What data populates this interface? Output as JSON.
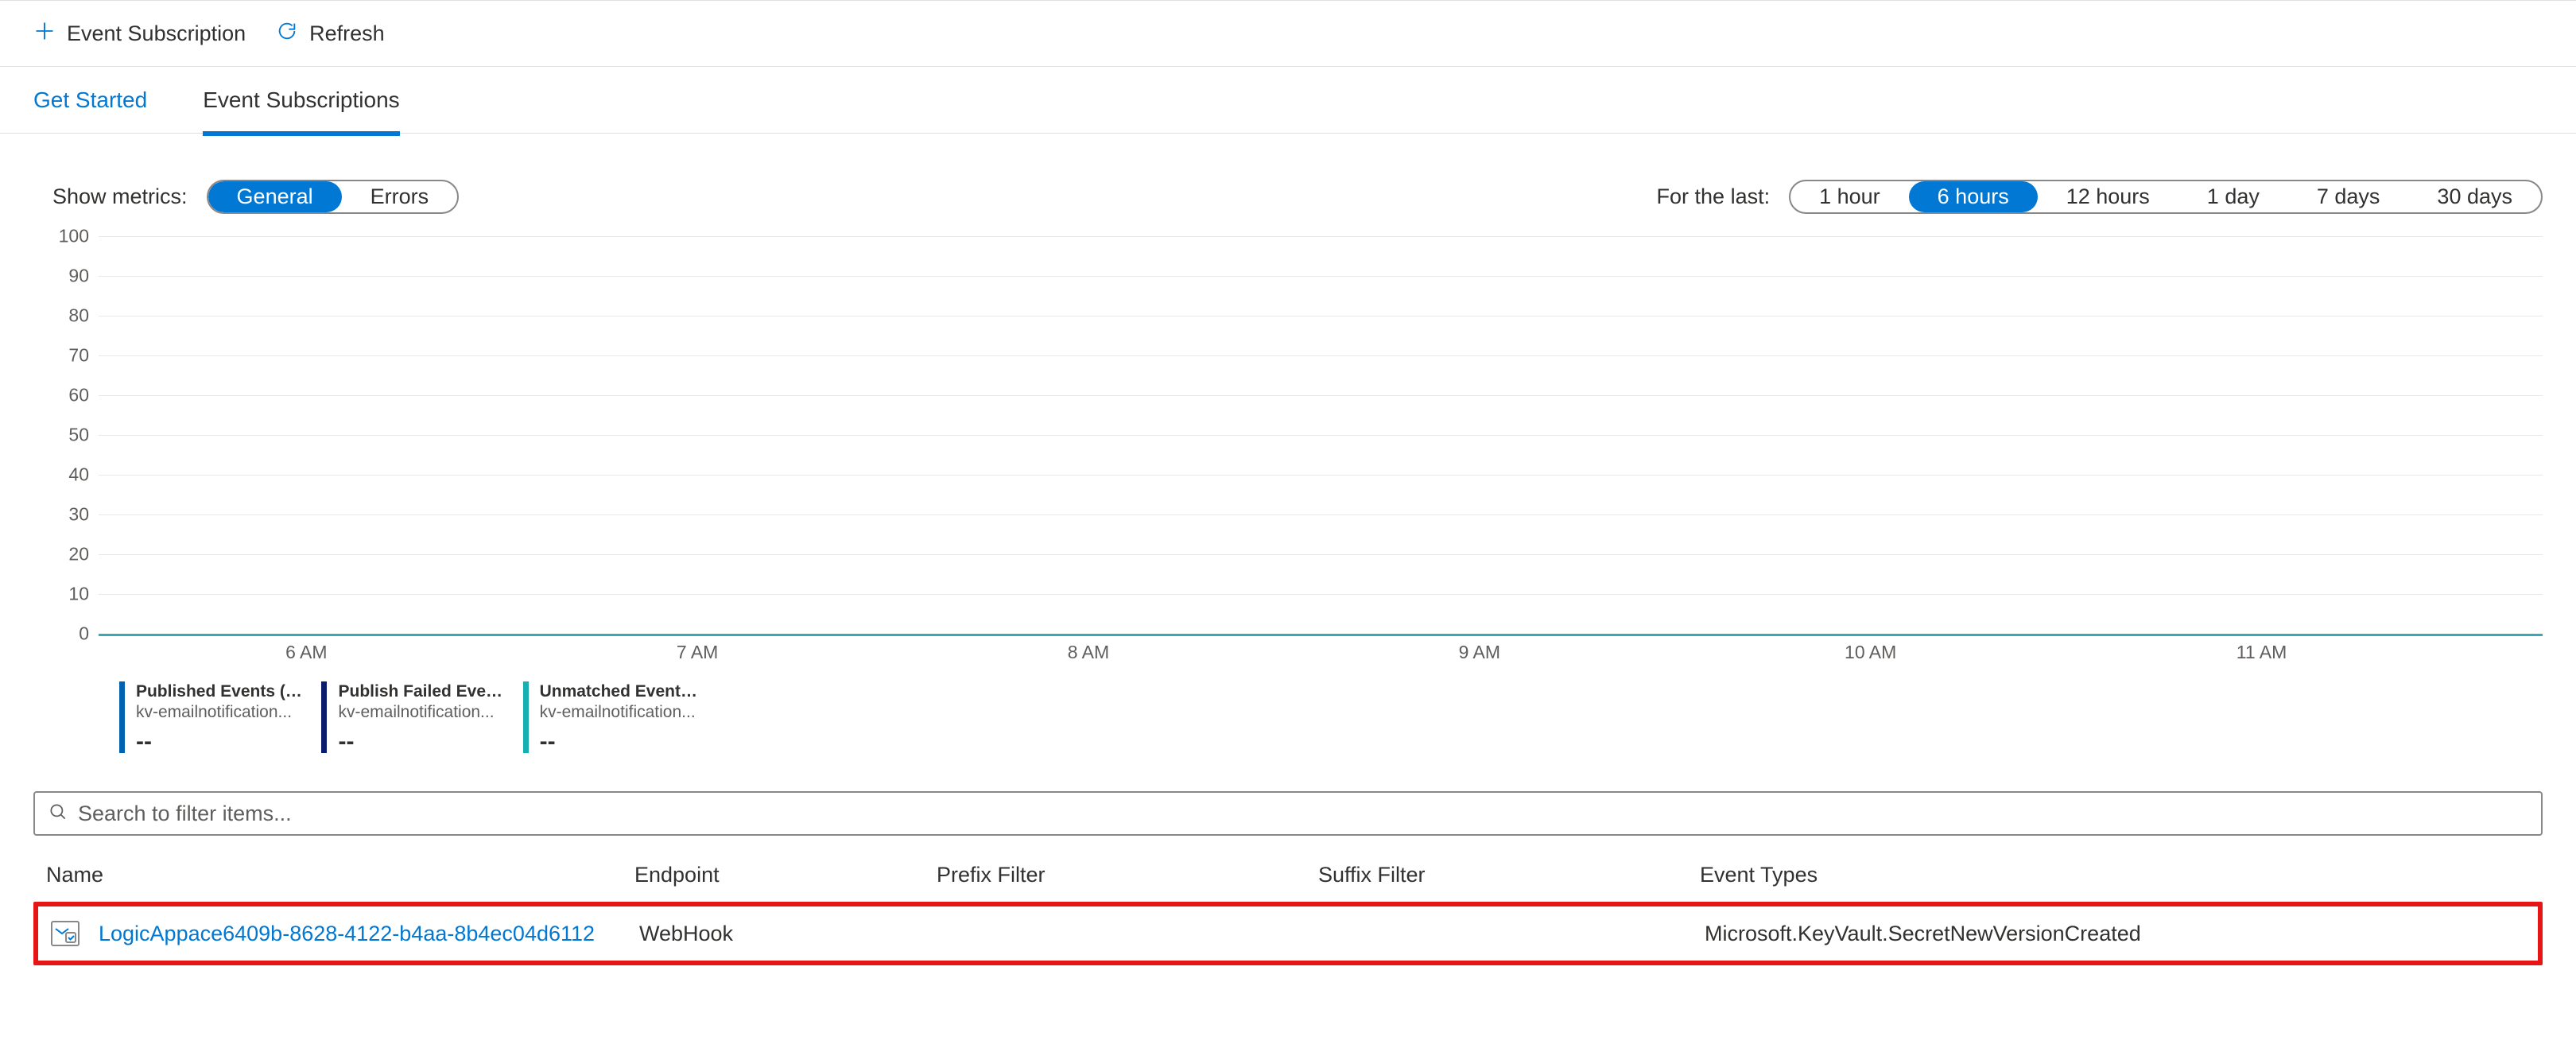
{
  "toolbar": {
    "add_label": "Event Subscription",
    "refresh_label": "Refresh"
  },
  "tabs": {
    "get_started": "Get Started",
    "event_subs": "Event Subscriptions"
  },
  "filters": {
    "show_metrics_label": "Show metrics:",
    "general": "General",
    "errors": "Errors",
    "for_the_last_label": "For the last:",
    "ranges": [
      "1 hour",
      "6 hours",
      "12 hours",
      "1 day",
      "7 days",
      "30 days"
    ],
    "selected_range_index": 1
  },
  "chart_data": {
    "type": "line",
    "ylim": [
      0,
      100
    ],
    "y_ticks": [
      0,
      10,
      20,
      30,
      40,
      50,
      60,
      70,
      80,
      90,
      100
    ],
    "x_ticks": [
      "6 AM",
      "7 AM",
      "8 AM",
      "9 AM",
      "10 AM",
      "11 AM"
    ],
    "series": [
      {
        "name": "Published Events (Sum)",
        "resource": "kv-emailnotification...",
        "color": "#0062b1",
        "value_display": "--",
        "values": [
          0,
          0,
          0,
          0,
          0,
          0
        ]
      },
      {
        "name": "Publish Failed Event...",
        "resource": "kv-emailnotification...",
        "color": "#0a1c6b",
        "value_display": "--",
        "values": [
          0,
          0,
          0,
          0,
          0,
          0
        ]
      },
      {
        "name": "Unmatched Events (Sum)",
        "resource": "kv-emailnotification...",
        "color": "#17b0b0",
        "value_display": "--",
        "values": [
          0,
          0,
          0,
          0,
          0,
          0
        ]
      }
    ]
  },
  "search": {
    "placeholder": "Search to filter items..."
  },
  "table": {
    "headers": {
      "name": "Name",
      "endpoint": "Endpoint",
      "prefix": "Prefix Filter",
      "suffix": "Suffix Filter",
      "types": "Event Types"
    },
    "rows": [
      {
        "name": "LogicAppace6409b-8628-4122-b4aa-8b4ec04d6112",
        "endpoint": "WebHook",
        "prefix": "",
        "suffix": "",
        "types": "Microsoft.KeyVault.SecretNewVersionCreated"
      }
    ]
  }
}
